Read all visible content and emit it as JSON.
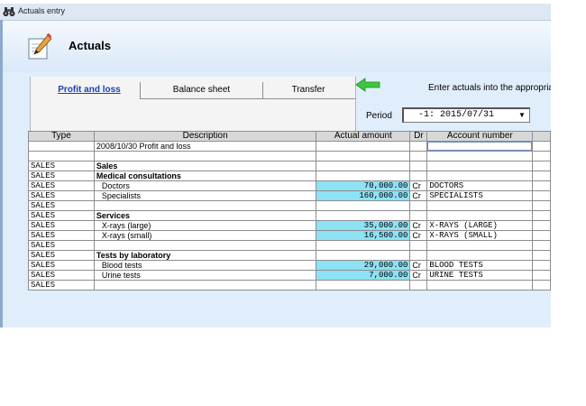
{
  "window": {
    "title": "Actuals entry"
  },
  "header": {
    "title": "Actuals"
  },
  "tabs": [
    {
      "label": "Profit and loss",
      "active": true
    },
    {
      "label": "Balance sheet",
      "active": false
    },
    {
      "label": "Transfer",
      "active": false
    }
  ],
  "hint": "Enter actuals into the appropria",
  "period": {
    "label": "Period",
    "value": "-1: 2015/07/31"
  },
  "table": {
    "columns": [
      "Type",
      "Description",
      "Actual amount",
      "Dr",
      "Account number"
    ],
    "rows": [
      {
        "type": "",
        "desc": "2008/10/30 Profit and loss",
        "amount": "",
        "dr": "",
        "acct": "",
        "bold": false
      },
      {
        "type": "",
        "desc": "",
        "amount": "",
        "dr": "",
        "acct": "",
        "bold": false
      },
      {
        "type": "SALES",
        "desc": "Sales",
        "amount": "",
        "dr": "",
        "acct": "",
        "bold": true
      },
      {
        "type": "SALES",
        "desc": "Medical consultations",
        "amount": "",
        "dr": "",
        "acct": "",
        "bold": true
      },
      {
        "type": "SALES",
        "desc": "Doctors",
        "amount": "70,000.00",
        "dr": "Cr",
        "acct": "DOCTORS",
        "bold": false
      },
      {
        "type": "SALES",
        "desc": "Specialists",
        "amount": "160,000.00",
        "dr": "Cr",
        "acct": "SPECIALISTS",
        "bold": false
      },
      {
        "type": "SALES",
        "desc": "",
        "amount": "",
        "dr": "",
        "acct": "",
        "bold": false
      },
      {
        "type": "SALES",
        "desc": "Services",
        "amount": "",
        "dr": "",
        "acct": "",
        "bold": true
      },
      {
        "type": "SALES",
        "desc": "X-rays (large)",
        "amount": "35,000.00",
        "dr": "Cr",
        "acct": "X-RAYS (LARGE)",
        "bold": false
      },
      {
        "type": "SALES",
        "desc": "X-rays (small)",
        "amount": "16,500.00",
        "dr": "Cr",
        "acct": "X-RAYS (SMALL)",
        "bold": false
      },
      {
        "type": "SALES",
        "desc": "",
        "amount": "",
        "dr": "",
        "acct": "",
        "bold": false
      },
      {
        "type": "SALES",
        "desc": "Tests by laboratory",
        "amount": "",
        "dr": "",
        "acct": "",
        "bold": true
      },
      {
        "type": "SALES",
        "desc": "Blood tests",
        "amount": "29,000.00",
        "dr": "Cr",
        "acct": "BLOOD TESTS",
        "bold": false
      },
      {
        "type": "SALES",
        "desc": "Urine tests",
        "amount": "7,000.00",
        "dr": "Cr",
        "acct": "URINE TESTS",
        "bold": false
      },
      {
        "type": "SALES",
        "desc": "",
        "amount": "",
        "dr": "",
        "acct": "",
        "bold": false
      }
    ]
  },
  "colors": {
    "amount_bg": "#8de2f5",
    "active_tab": "#1a3fb5",
    "arrow": "#3fc63f"
  },
  "icons": {
    "app": "binoculars-icon",
    "header": "pen-paper-icon",
    "hint": "green-left-arrow-icon"
  }
}
